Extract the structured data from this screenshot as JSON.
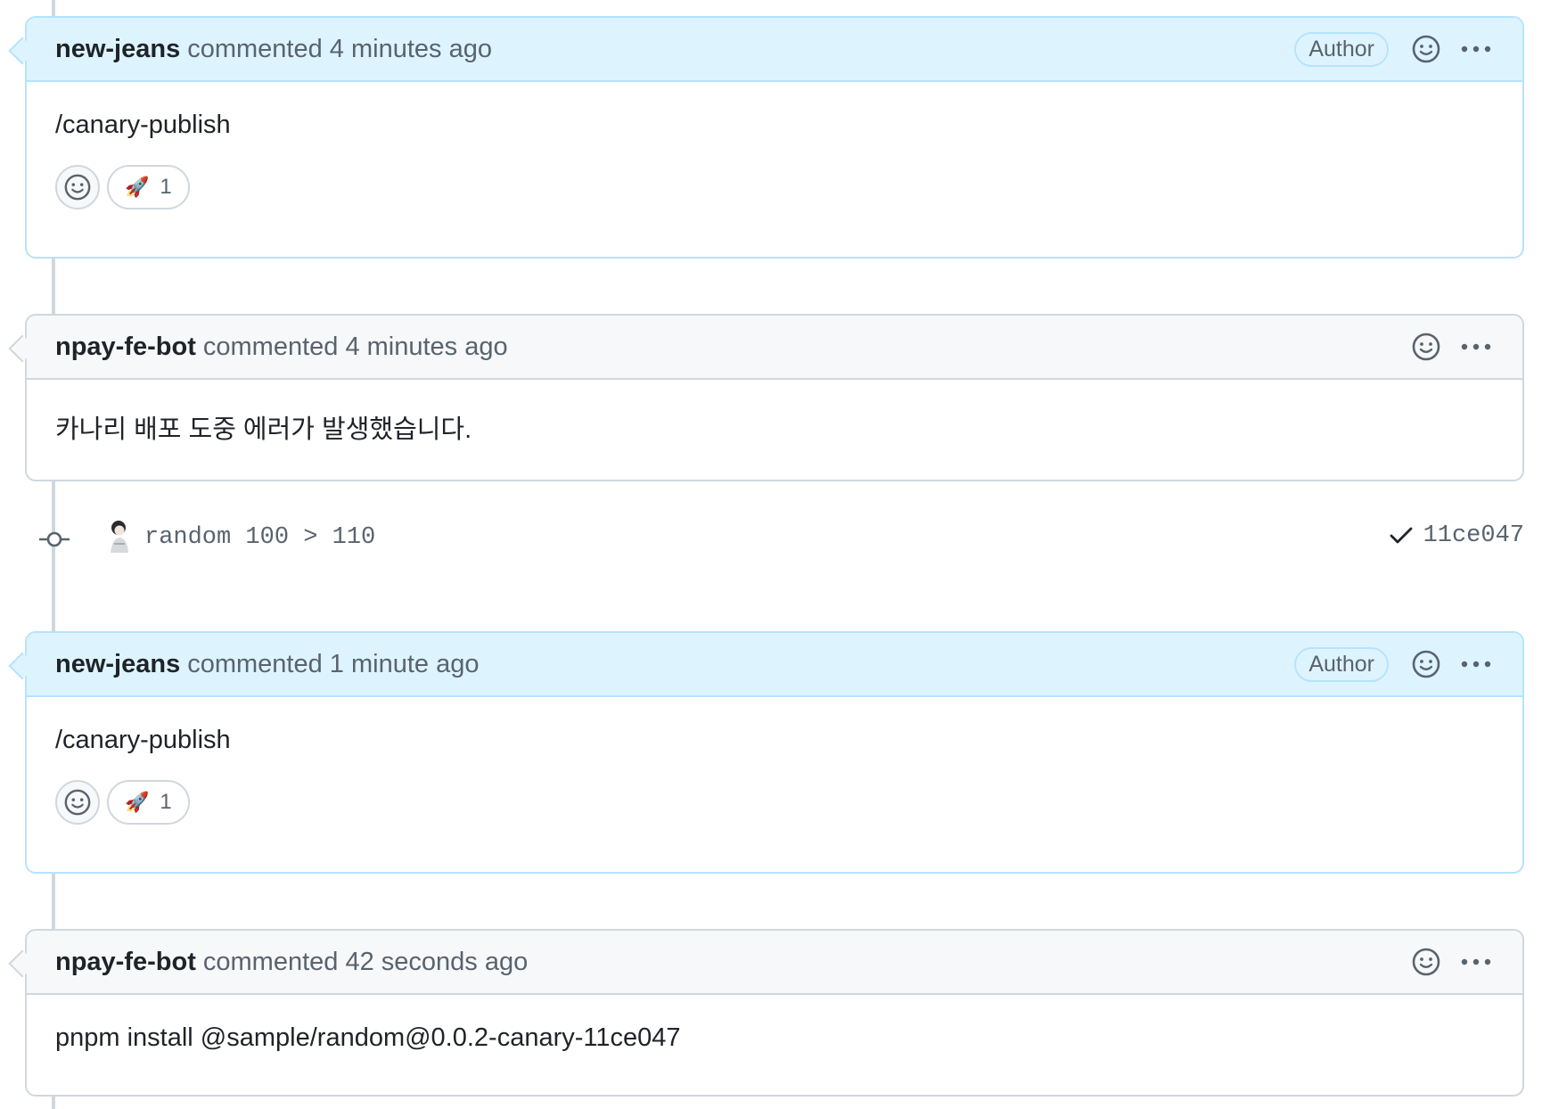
{
  "comments": [
    {
      "author": "new-jeans",
      "meta": "commented 4 minutes ago",
      "badge": "Author",
      "body": "/canary-publish",
      "reaction": {
        "emoji": "🚀",
        "count": "1"
      }
    },
    {
      "author": "npay-fe-bot",
      "meta": "commented 4 minutes ago",
      "body": "카나리 배포 도중 에러가 발생했습니다."
    },
    {
      "author": "new-jeans",
      "meta": "commented 1 minute ago",
      "badge": "Author",
      "body": "/canary-publish",
      "reaction": {
        "emoji": "🚀",
        "count": "1"
      }
    },
    {
      "author": "npay-fe-bot",
      "meta": "commented 42 seconds ago",
      "body": "pnpm install @sample/random@0.0.2-canary-11ce047"
    }
  ],
  "commit": {
    "message": "random 100 > 110",
    "sha": "11ce047",
    "status_icon": "check-icon",
    "node_icon": "git-commit-icon"
  },
  "icons": {
    "add_reaction": "smiley-icon",
    "more": "kebab-horizontal-icon"
  },
  "colors": {
    "author_header_bg": "#ddf4ff",
    "author_border": "#b6e3ff",
    "default_header_bg": "#f6f8fa",
    "border": "#d0d7de",
    "muted_text": "#59636e"
  }
}
